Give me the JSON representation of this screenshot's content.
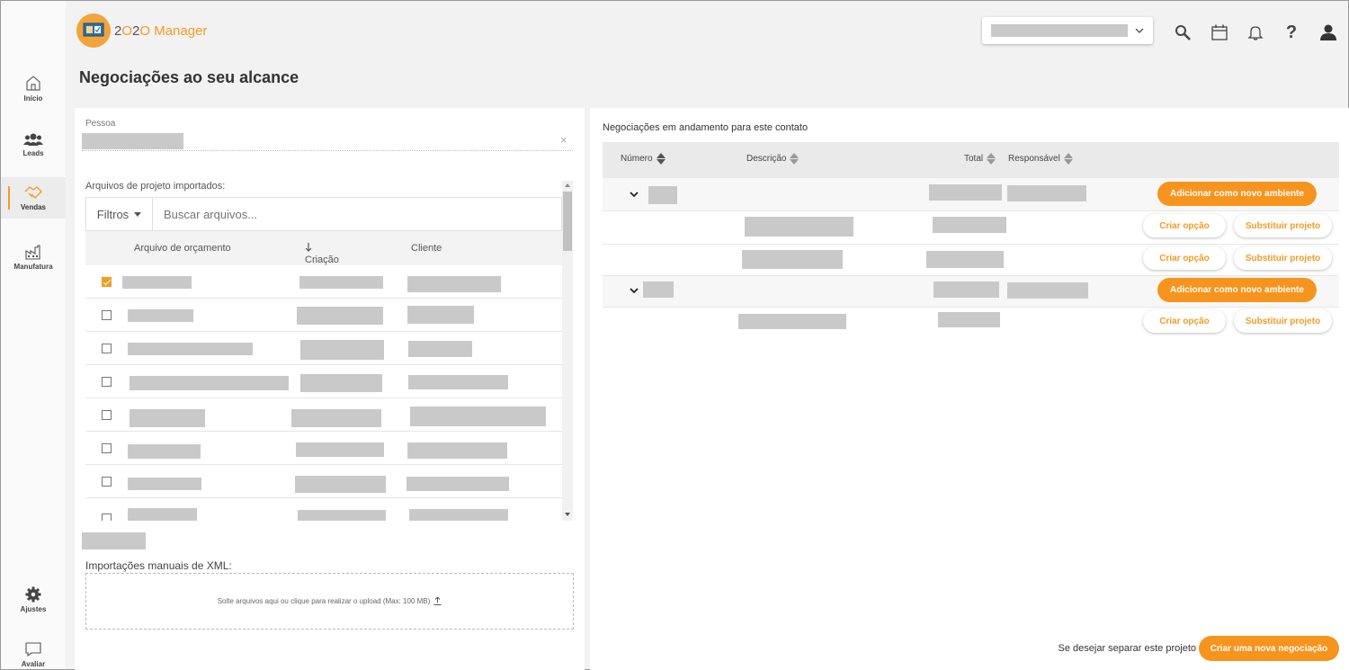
{
  "app": {
    "name_prefix": "2",
    "name_o": "O",
    "name_mid": "2",
    "name_o2": "O",
    "name_suffix": " Manager"
  },
  "colors": {
    "accent": "#f39c23",
    "orange_button": "#f7941d",
    "redaction": "#c9c9c9"
  },
  "sidebar": {
    "items": [
      {
        "label": "Início",
        "icon": "home-icon"
      },
      {
        "label": "Leads",
        "icon": "users-icon"
      },
      {
        "label": "Vendas",
        "icon": "handshake-icon",
        "active": true
      },
      {
        "label": "Manufatura",
        "icon": "factory-icon"
      }
    ],
    "bottom": [
      {
        "label": "Ajustes",
        "icon": "gear-icon"
      },
      {
        "label": "Avaliar",
        "icon": "chat-icon"
      }
    ]
  },
  "header": {
    "icons": [
      "search-icon",
      "calendar-icon",
      "bell-icon",
      "help-icon",
      "user-icon"
    ],
    "help_glyph": "?"
  },
  "page": {
    "title": "Negociações ao seu alcance"
  },
  "left": {
    "person_label": "Pessoa",
    "clear_glyph": "×",
    "files_label": "Arquivos de projeto importados:",
    "filters_label": "Filtros",
    "search_placeholder": "Buscar arquivos...",
    "columns": {
      "file": "Arquivo de orçamento",
      "created": "Criação",
      "client": "Cliente"
    },
    "manual_label": "Importações manuais de XML:",
    "dropzone_text": "Solte arquivos aqui ou clique para realizar o upload (Max: 100 MB)"
  },
  "right": {
    "title": "Negociações em andamento para este contato",
    "columns": {
      "number": "Número",
      "description": "Descrição",
      "total": "Total",
      "responsible": "Responsável"
    },
    "add_env_label": "Adicionar como novo ambiente",
    "create_option_label": "Criar opção",
    "replace_project_label": "Substituir projeto",
    "footer_text": "Se desejar separar este projeto",
    "new_negotiation_label": "Criar uma nova negociação"
  }
}
